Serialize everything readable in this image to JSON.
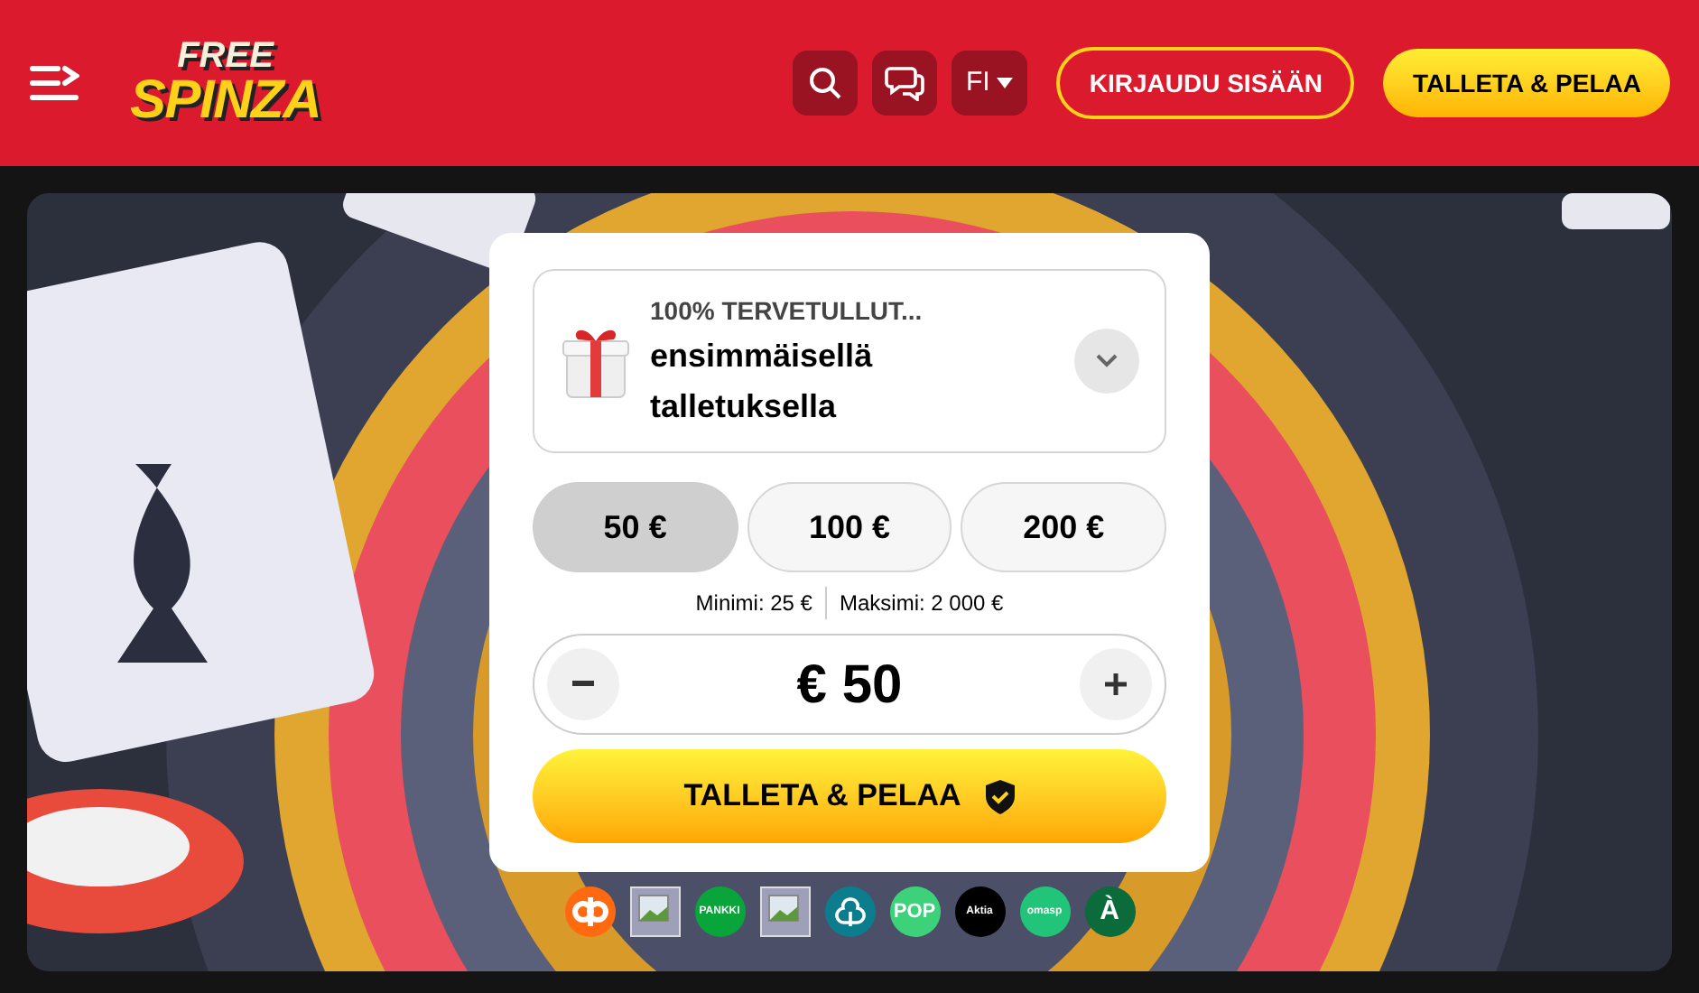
{
  "header": {
    "logo": {
      "line_1": "FREE",
      "line_2": "SPINZA"
    },
    "language": "FI",
    "login_button": "KIRJAUDU SISÄÄN",
    "deposit_button": "TALLETA & PELAA"
  },
  "bonus": {
    "title": "100% TERVETULLUT...",
    "description": "ensimmäisellä talletuksella",
    "expanded": false
  },
  "amounts": [
    {
      "label": "50 €",
      "selected": true
    },
    {
      "label": "100 €",
      "selected": false
    },
    {
      "label": "200 €",
      "selected": false
    }
  ],
  "limits": {
    "min": "Minimi: 25 €",
    "max": "Maksimi: 2 000 €"
  },
  "amount": {
    "value": "€ 50"
  },
  "submit_button": "TALLETA & PELAA",
  "payment_methods": [
    {
      "kind": "op",
      "color": "#ff6a10"
    },
    {
      "kind": "broken"
    },
    {
      "kind": "badge",
      "label": "PANKKI",
      "color": "#0aa53a"
    },
    {
      "kind": "broken"
    },
    {
      "kind": "clover",
      "color": "#0b7d8c"
    },
    {
      "kind": "badge",
      "label": "POP",
      "color": "#3dd27a"
    },
    {
      "kind": "badge",
      "label": "Aktia",
      "color": "#000000"
    },
    {
      "kind": "badge",
      "label": "omasp",
      "color": "#22c47a"
    },
    {
      "kind": "badge",
      "label": "À",
      "color": "#0b6b3a"
    }
  ]
}
